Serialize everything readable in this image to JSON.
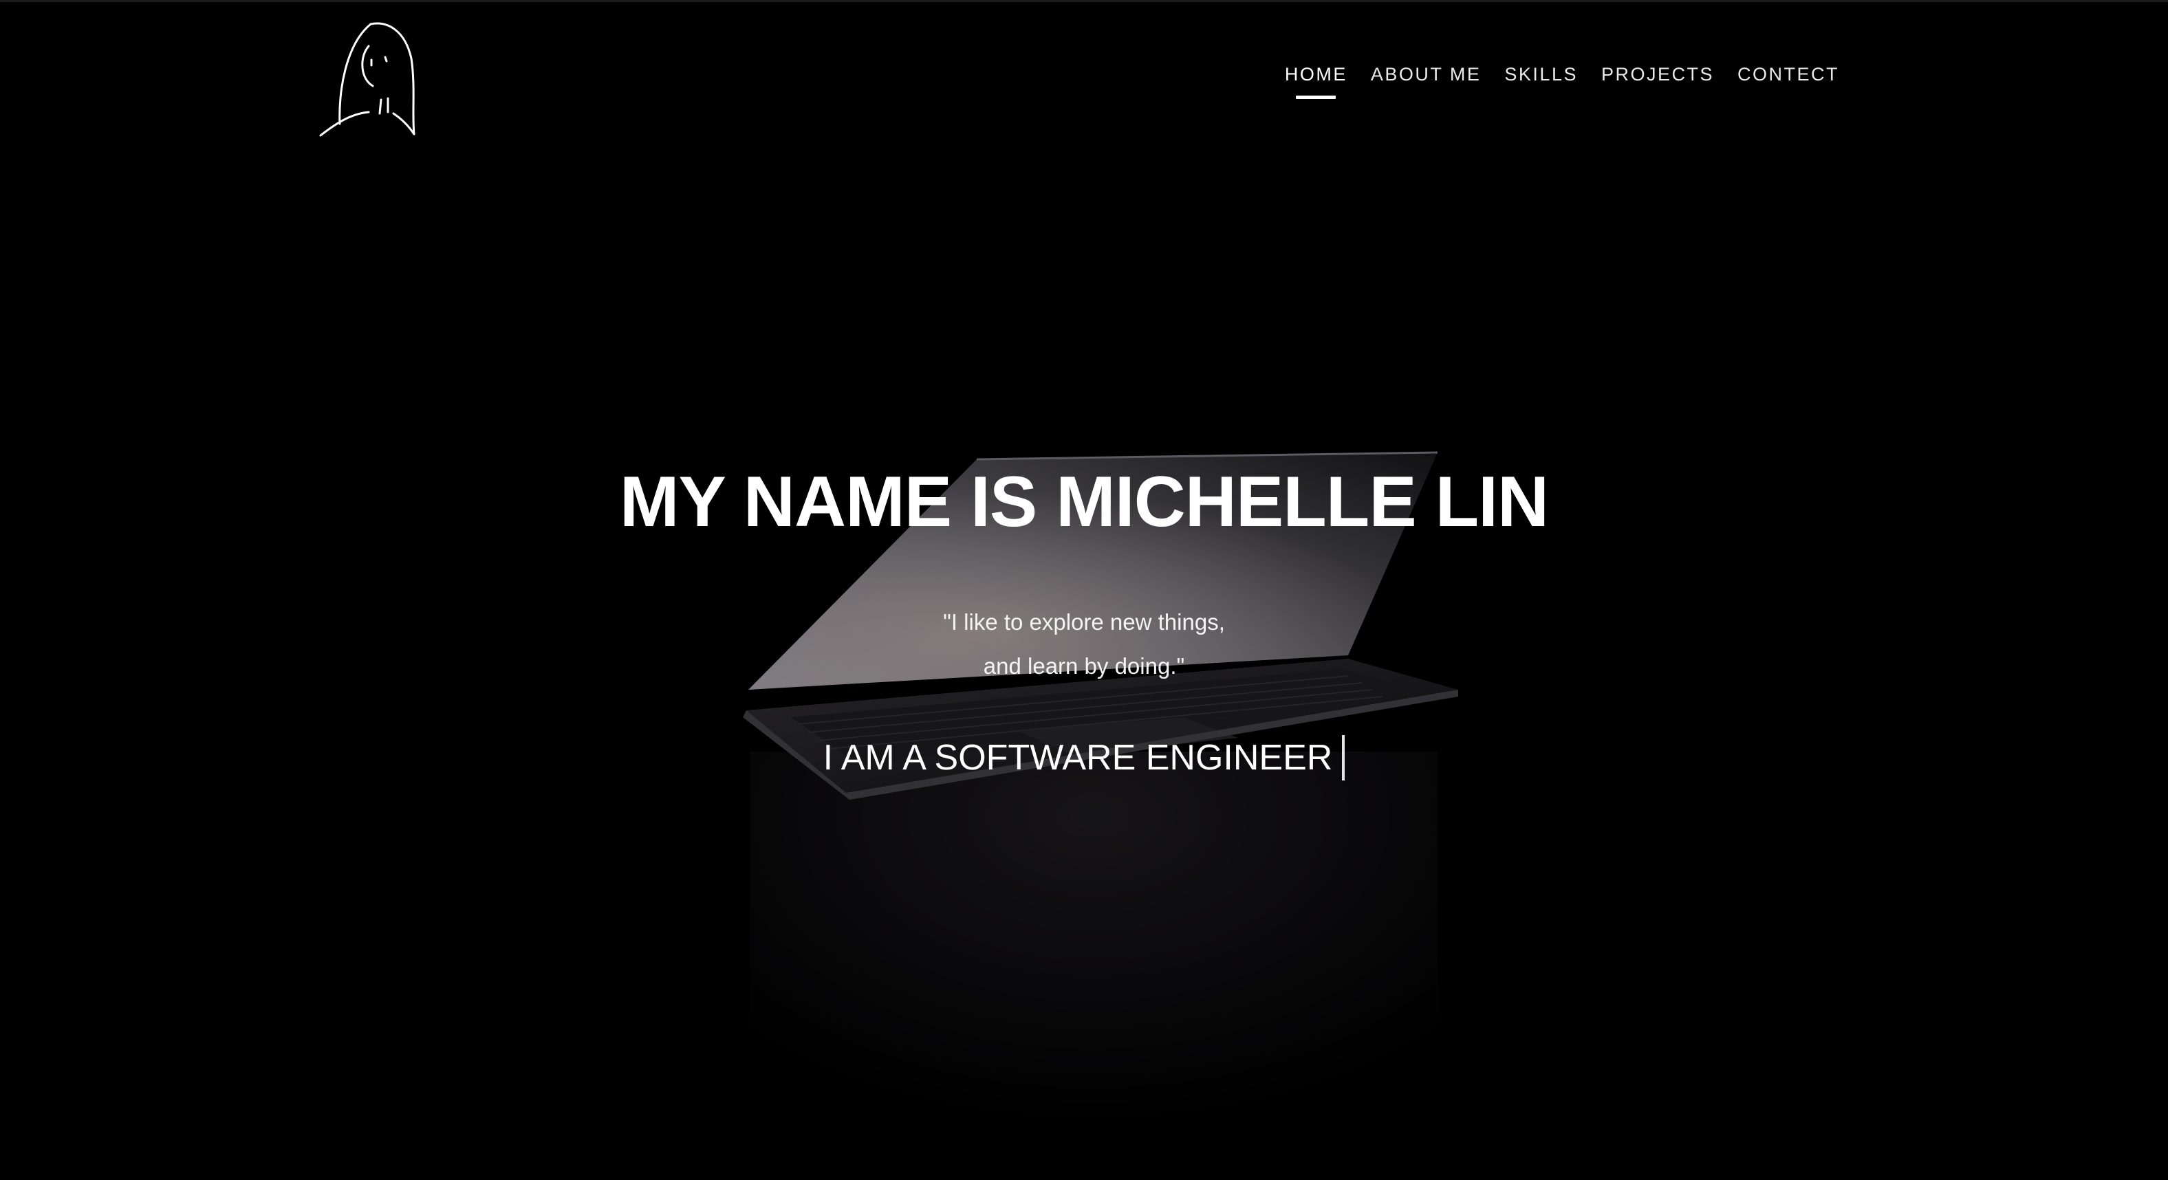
{
  "header": {
    "logo_icon": "girl-line-drawing-icon",
    "nav": [
      {
        "label": "HOME",
        "active": true
      },
      {
        "label": "ABOUT ME",
        "active": false
      },
      {
        "label": "SKILLS",
        "active": false
      },
      {
        "label": "PROJECTS",
        "active": false
      },
      {
        "label": "CONTECT",
        "active": false
      }
    ]
  },
  "hero": {
    "background_image": "dark-laptop-photo",
    "title": "MY NAME IS MICHELLE LIN",
    "quote_line_1": "\"I like to explore new things,",
    "quote_line_2": "and learn by doing.\"",
    "typed_text": "I AM A SOFTWARE ENGINEER"
  },
  "colors": {
    "background": "#000000",
    "text": "#ffffff"
  }
}
